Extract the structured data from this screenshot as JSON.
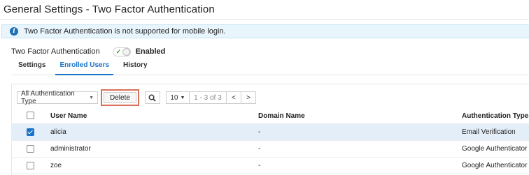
{
  "header": {
    "title": "General Settings - Two Factor Authentication"
  },
  "info": {
    "message": "Two Factor Authentication is not supported for mobile login."
  },
  "tfa": {
    "label": "Two Factor Authentication",
    "state": "Enabled"
  },
  "tabs": [
    {
      "label": "Settings",
      "active": false
    },
    {
      "label": "Enrolled Users",
      "active": true
    },
    {
      "label": "History",
      "active": false
    }
  ],
  "toolbar": {
    "filter_value": "All Authentication Type",
    "delete_label": "Delete",
    "page_size": "10",
    "page_range": "1 - 3 of 3"
  },
  "table": {
    "headers": {
      "user": "User Name",
      "domain": "Domain Name",
      "auth": "Authentication Type"
    },
    "rows": [
      {
        "user": "alicia",
        "domain": "-",
        "auth": "Email Verification",
        "selected": true
      },
      {
        "user": "administrator",
        "domain": "-",
        "auth": "Google Authenticator",
        "selected": false
      },
      {
        "user": "zoe",
        "domain": "-",
        "auth": "Google Authenticator",
        "selected": false
      }
    ]
  },
  "colors": {
    "accent": "#1a73c8",
    "highlight": "#d9705a",
    "banner": "#e8f5fd"
  }
}
